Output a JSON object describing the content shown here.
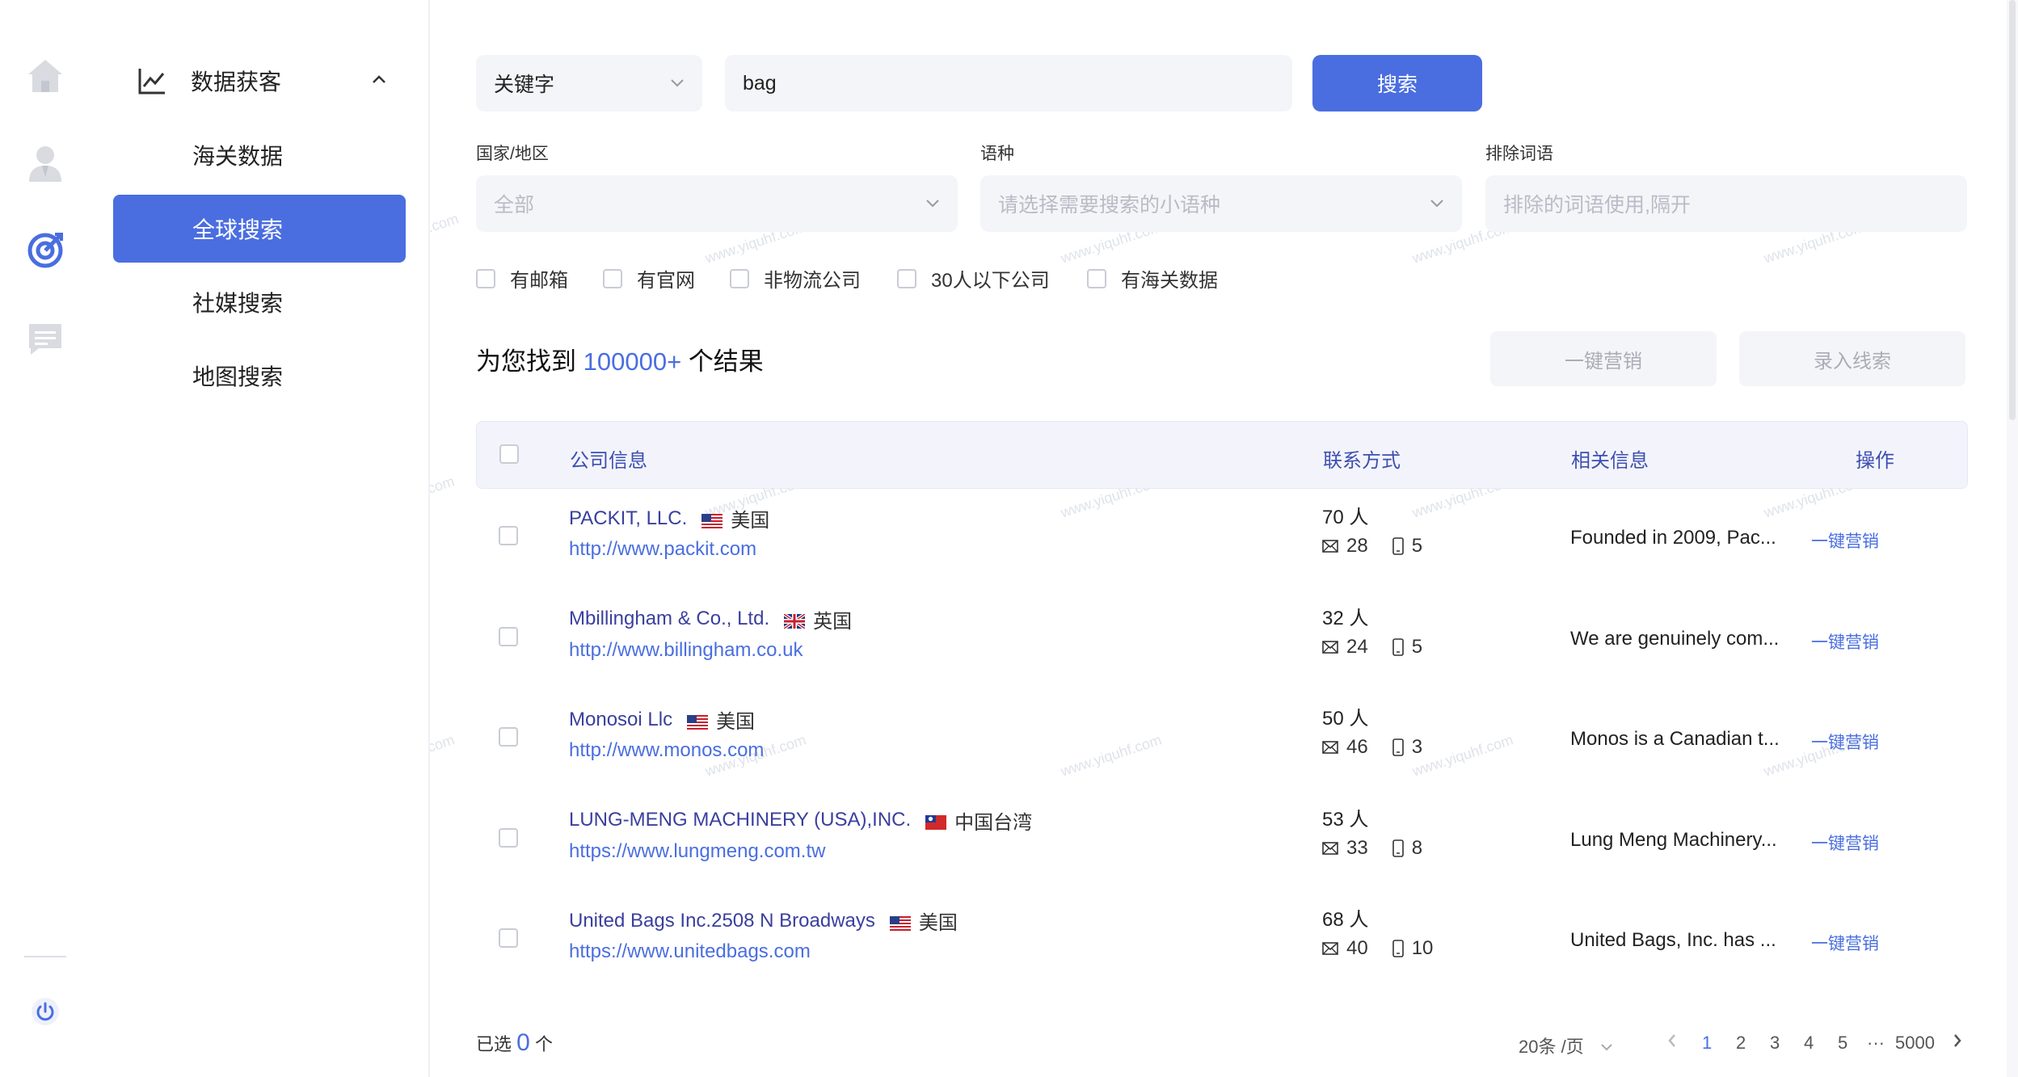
{
  "nav": {
    "menu_title": "数据获客",
    "items": [
      {
        "label": "海关数据"
      },
      {
        "label": "全球搜索"
      },
      {
        "label": "社媒搜索"
      },
      {
        "label": "地图搜索"
      }
    ]
  },
  "search": {
    "type_value": "关键字",
    "query": "bag",
    "button": "搜索"
  },
  "filters": {
    "country_label": "国家/地区",
    "country_value": "全部",
    "language_label": "语种",
    "language_placeholder": "请选择需要搜索的小语种",
    "exclude_label": "排除词语",
    "exclude_placeholder": "排除的词语使用,隔开",
    "checkboxes": [
      {
        "label": "有邮箱"
      },
      {
        "label": "有官网"
      },
      {
        "label": "非物流公司"
      },
      {
        "label": "30人以下公司"
      },
      {
        "label": "有海关数据"
      }
    ]
  },
  "results": {
    "prefix": "为您找到",
    "count": "100000+",
    "suffix": "个结果",
    "btn_marketing": "一键营销",
    "btn_leads": "录入线索"
  },
  "table": {
    "headers": {
      "company": "公司信息",
      "contact": "联系方式",
      "related": "相关信息",
      "action": "操作"
    },
    "rows": [
      {
        "name": "PACKIT, LLC.",
        "flag": "us-flag",
        "country": "美国",
        "url": "http://www.packit.com",
        "people": "70 人",
        "emails": "28",
        "phones": "5",
        "desc": "Founded in 2009, Pac...",
        "action": "一键营销"
      },
      {
        "name": "Mbillingham & Co., Ltd.",
        "flag": "uk-flag",
        "country": "英国",
        "url": "http://www.billingham.co.uk",
        "people": "32 人",
        "emails": "24",
        "phones": "5",
        "desc": "We are genuinely com...",
        "action": "一键营销"
      },
      {
        "name": "Monosoi Llc",
        "flag": "us-flag",
        "country": "美国",
        "url": "http://www.monos.com",
        "people": "50 人",
        "emails": "46",
        "phones": "3",
        "desc": "Monos is a Canadian t...",
        "action": "一键营销"
      },
      {
        "name": "LUNG-MENG MACHINERY (USA),INC.",
        "flag": "tw-flag",
        "country": "中国台湾",
        "url": "https://www.lungmeng.com.tw",
        "people": "53 人",
        "emails": "33",
        "phones": "8",
        "desc": "Lung Meng Machinery...",
        "action": "一键营销"
      },
      {
        "name": "United Bags Inc.2508 N Broadways",
        "flag": "us-flag",
        "country": "美国",
        "url": "https://www.unitedbags.com",
        "people": "68 人",
        "emails": "40",
        "phones": "10",
        "desc": "United Bags, Inc. has ...",
        "action": "一键营销"
      }
    ]
  },
  "footer": {
    "selected_prefix": "已选",
    "selected_count": "0",
    "selected_suffix": "个",
    "page_size": "20条 /页",
    "pages": [
      "1",
      "2",
      "3",
      "4",
      "5"
    ],
    "ellipsis": "···",
    "last_page": "5000",
    "current_page": "1"
  },
  "watermark": "www.yiquhf.com",
  "colors": {
    "accent": "#4a6ee0",
    "link": "#3a3f9e"
  }
}
